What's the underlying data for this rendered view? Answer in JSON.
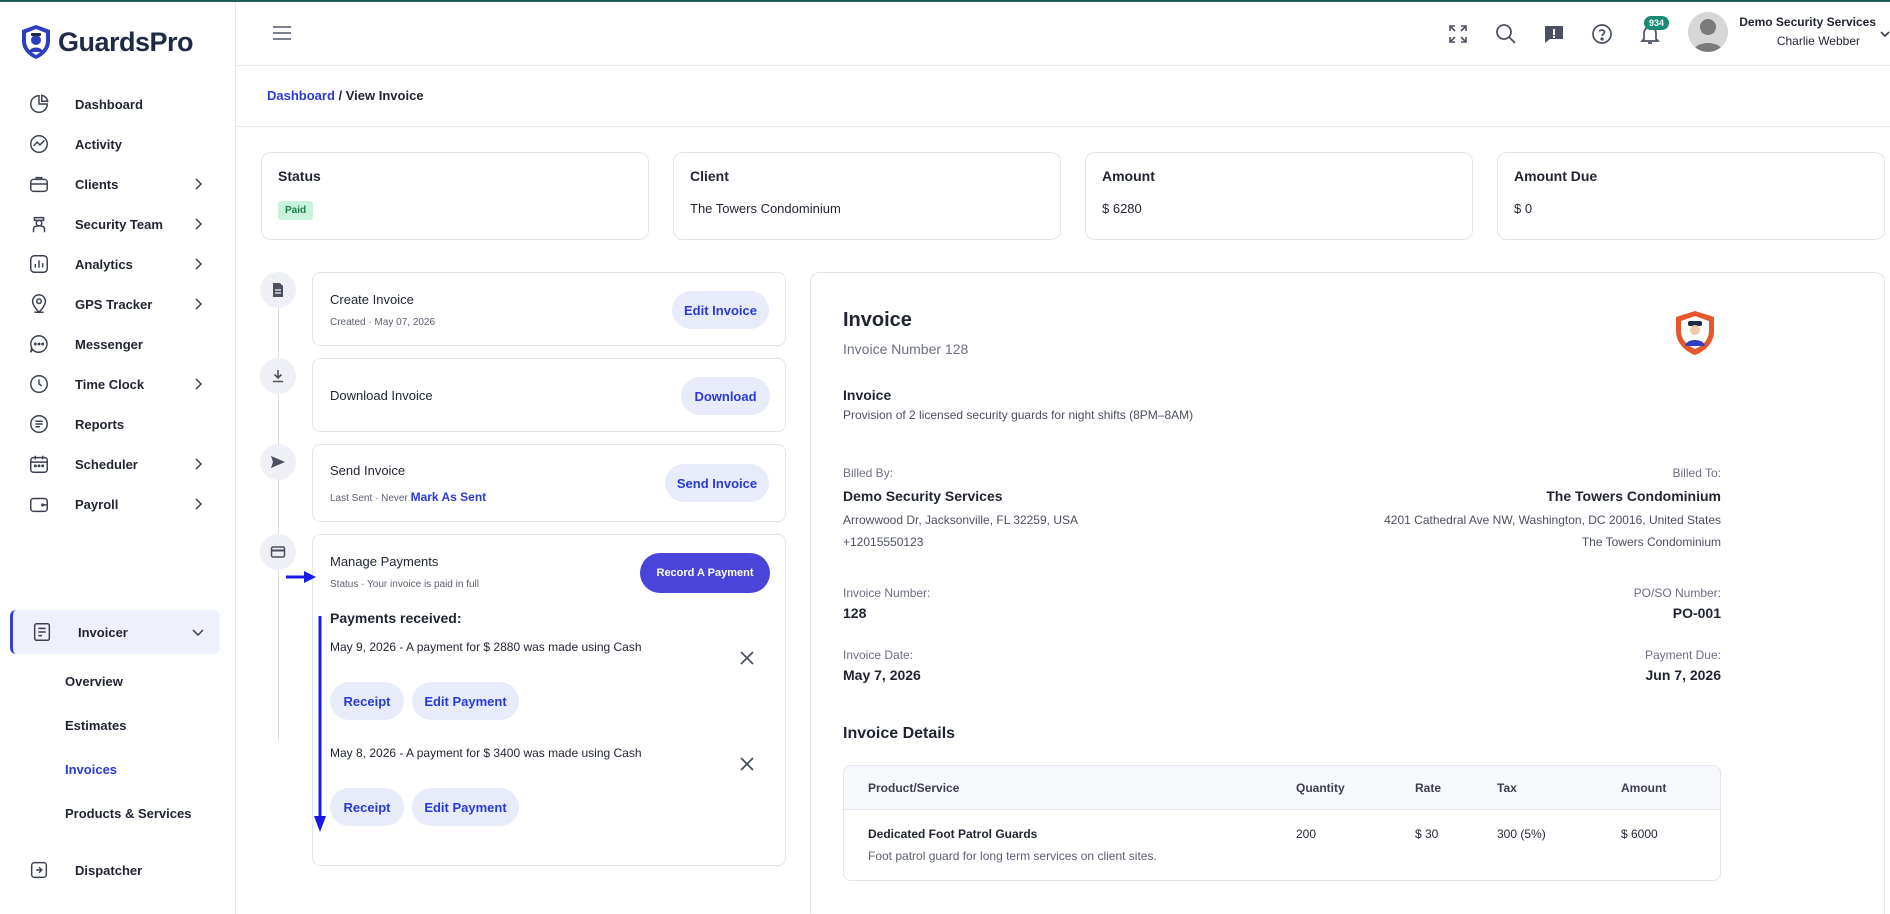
{
  "app": {
    "brand_name": "GuardsPro",
    "accent": "#2a3ad6",
    "primary_button": "#4b44d9"
  },
  "sidebar": {
    "items": [
      {
        "label": "Dashboard",
        "icon": "pie-chart-icon"
      },
      {
        "label": "Activity",
        "icon": "activity-chart-icon"
      },
      {
        "label": "Clients",
        "icon": "briefcase-icon"
      },
      {
        "label": "Security Team",
        "icon": "guard-icon"
      },
      {
        "label": "Analytics",
        "icon": "analytics-icon"
      },
      {
        "label": "GPS Tracker",
        "icon": "location-pin-icon"
      },
      {
        "label": "Messenger",
        "icon": "chat-bubble-icon"
      },
      {
        "label": "Time Clock",
        "icon": "clock-icon"
      },
      {
        "label": "Reports",
        "icon": "report-list-icon"
      },
      {
        "label": "Scheduler",
        "icon": "calendar-icon"
      },
      {
        "label": "Payroll",
        "icon": "wallet-icon"
      },
      {
        "label": "Invoicer",
        "icon": "invoice-icon"
      },
      {
        "label": "Dispatcher",
        "icon": "dispatch-icon"
      }
    ],
    "invoicer_sub": [
      "Overview",
      "Estimates",
      "Invoices",
      "Products & Services"
    ]
  },
  "header": {
    "notification_count": "934",
    "company": "Demo Security Services",
    "user": "Charlie Webber"
  },
  "breadcrumb": {
    "link": "Dashboard",
    "separator": " / ",
    "current": "View Invoice"
  },
  "summary": {
    "status_title": "Status",
    "status_value": "Paid",
    "client_title": "Client",
    "client_value": "The Towers Condominium",
    "amount_title": "Amount",
    "amount_value": "$ 6280",
    "due_title": "Amount Due",
    "due_value": "$ 0"
  },
  "timeline": {
    "create": {
      "title": "Create Invoice",
      "sub": "Created · May 07, 2026",
      "button": "Edit Invoice"
    },
    "download": {
      "title": "Download Invoice",
      "button": "Download"
    },
    "send": {
      "title": "Send Invoice",
      "sub": "Last Sent · Never",
      "mark_sent": "Mark As Sent",
      "button": "Send Invoice"
    },
    "payments": {
      "title": "Manage Payments",
      "sub": "Status · Your invoice is paid in full",
      "button": "Record A Payment",
      "heading": "Payments received:",
      "list": [
        {
          "text": "May 9, 2026 - A payment for $ 2880 was made using Cash",
          "receipt": "Receipt",
          "edit": "Edit Payment"
        },
        {
          "text": "May 8, 2026 - A payment for $ 3400 was made using Cash",
          "receipt": "Receipt",
          "edit": "Edit Payment"
        }
      ]
    }
  },
  "invoice": {
    "title": "Invoice",
    "number_line": "Invoice Number 128",
    "subtitle": "Invoice",
    "description": "Provision of 2 licensed security guards for night shifts (8PM–8AM)",
    "billed_by_label": "Billed By:",
    "billed_by_name": "Demo Security Services",
    "billed_by_address": "Arrowwood Dr, Jacksonville, FL 32259, USA",
    "billed_by_phone": "+12015550123",
    "billed_to_label": "Billed To:",
    "billed_to_name": "The Towers Condominium",
    "billed_to_address": "4201 Cathedral Ave NW, Washington, DC 20016, United States",
    "billed_to_extra": "The Towers Condominium",
    "invoice_number_label": "Invoice Number:",
    "invoice_number": "128",
    "po_label": "PO/SO Number:",
    "po_number": "PO-001",
    "invoice_date_label": "Invoice Date:",
    "invoice_date": "May 7, 2026",
    "payment_due_label": "Payment Due:",
    "payment_due": "Jun 7, 2026",
    "details_heading": "Invoice Details",
    "columns": [
      "Product/Service",
      "Quantity",
      "Rate",
      "Tax",
      "Amount"
    ],
    "rows": [
      {
        "product": "Dedicated Foot Patrol Guards",
        "desc": "Foot patrol guard for long term services on client sites.",
        "quantity": "200",
        "rate": "$ 30",
        "tax": "300 (5%)",
        "amount": "$ 6000"
      }
    ]
  }
}
